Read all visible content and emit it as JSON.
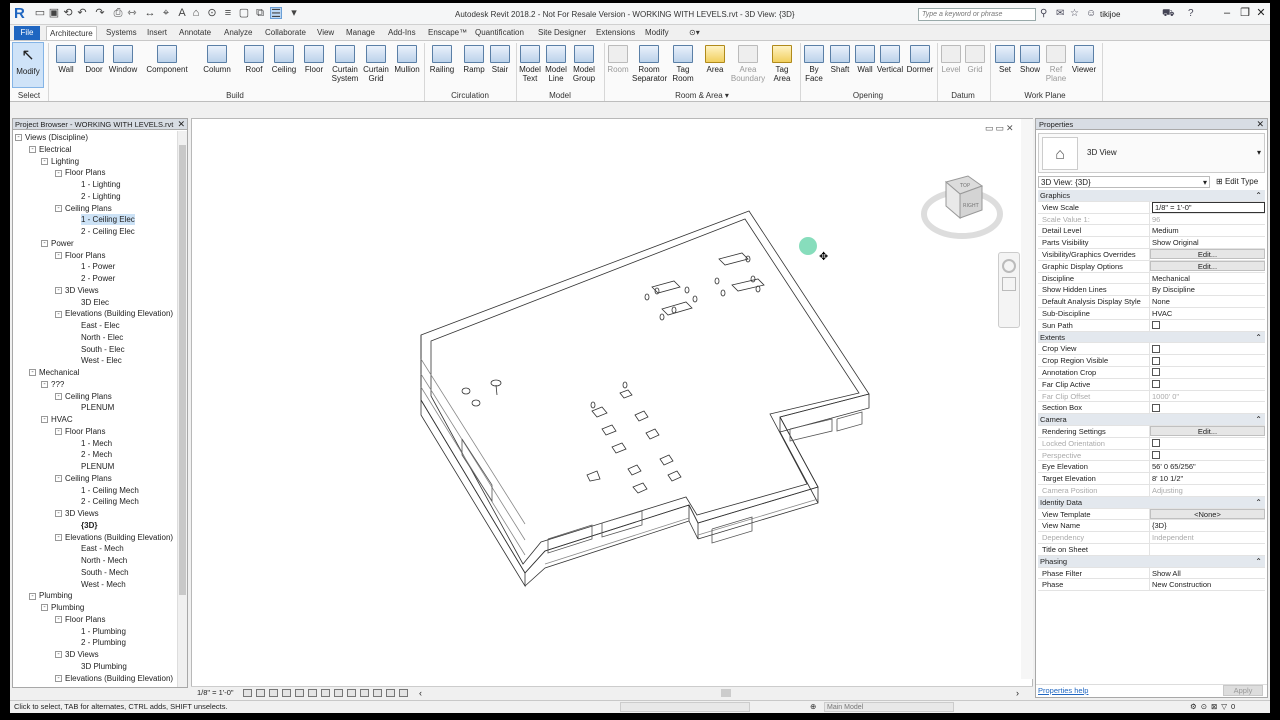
{
  "titlebar": {
    "window_title": "Autodesk Revit 2018.2 - Not For Resale Version -    WORKING WITH LEVELS.rvt - 3D View: {3D}",
    "search_placeholder": "Type a keyword or phrase",
    "username": "tikijoe"
  },
  "tabs": [
    "File",
    "Architecture",
    "Systems",
    "Insert",
    "Annotate",
    "Analyze",
    "Collaborate",
    "View",
    "Manage",
    "Add-Ins",
    "Enscape™",
    "Quantification",
    "Site Designer",
    "Extensions",
    "Modify"
  ],
  "ribbon": {
    "select_label": "Select",
    "modify": "Modify",
    "build": [
      "Wall",
      "Door",
      "Window",
      "Component",
      "Column",
      "Roof",
      "Ceiling",
      "Floor",
      "Curtain System",
      "Curtain Grid",
      "Mullion"
    ],
    "circulation": [
      "Railing",
      "Ramp",
      "Stair"
    ],
    "model": [
      "Model Text",
      "Model Line",
      "Model Group"
    ],
    "room_area": [
      "Room",
      "Room Separator",
      "Tag Room",
      "Area",
      "Area Boundary",
      "Tag Area"
    ],
    "opening": [
      "By Face",
      "Shaft",
      "Wall",
      "Vertical",
      "Dormer"
    ],
    "datum": [
      "Level",
      "Grid"
    ],
    "work_plane": [
      "Set",
      "Show",
      "Ref Plane",
      "Viewer"
    ],
    "panels": {
      "build": "Build",
      "circulation": "Circulation",
      "model": "Model",
      "room_area": "Room & Area",
      "opening": "Opening",
      "datum": "Datum",
      "work_plane": "Work Plane"
    }
  },
  "project_browser": {
    "title": "Project Browser - WORKING WITH LEVELS.rvt",
    "tree": [
      {
        "label": "Views (Discipline)",
        "level": 0,
        "toggle": "-"
      },
      {
        "label": "Electrical",
        "level": 1,
        "toggle": "-"
      },
      {
        "label": "Lighting",
        "level": 2,
        "toggle": "-"
      },
      {
        "label": "Floor Plans",
        "level": 3,
        "toggle": "-"
      },
      {
        "label": "1 - Lighting",
        "level": 4
      },
      {
        "label": "2 - Lighting",
        "level": 4
      },
      {
        "label": "Ceiling Plans",
        "level": 3,
        "toggle": "-"
      },
      {
        "label": "1 - Ceiling Elec",
        "level": 4,
        "selected": true
      },
      {
        "label": "2 - Ceiling Elec",
        "level": 4
      },
      {
        "label": "Power",
        "level": 2,
        "toggle": "-"
      },
      {
        "label": "Floor Plans",
        "level": 3,
        "toggle": "-"
      },
      {
        "label": "1 - Power",
        "level": 4
      },
      {
        "label": "2 - Power",
        "level": 4
      },
      {
        "label": "3D Views",
        "level": 3,
        "toggle": "-"
      },
      {
        "label": "3D Elec",
        "level": 4
      },
      {
        "label": "Elevations (Building Elevation)",
        "level": 3,
        "toggle": "-"
      },
      {
        "label": "East - Elec",
        "level": 4
      },
      {
        "label": "North - Elec",
        "level": 4
      },
      {
        "label": "South - Elec",
        "level": 4
      },
      {
        "label": "West - Elec",
        "level": 4
      },
      {
        "label": "Mechanical",
        "level": 1,
        "toggle": "-"
      },
      {
        "label": "???",
        "level": 2,
        "toggle": "-"
      },
      {
        "label": "Ceiling Plans",
        "level": 3,
        "toggle": "-"
      },
      {
        "label": "PLENUM",
        "level": 4
      },
      {
        "label": "HVAC",
        "level": 2,
        "toggle": "-"
      },
      {
        "label": "Floor Plans",
        "level": 3,
        "toggle": "-"
      },
      {
        "label": "1 - Mech",
        "level": 4
      },
      {
        "label": "2 - Mech",
        "level": 4
      },
      {
        "label": "PLENUM",
        "level": 4
      },
      {
        "label": "Ceiling Plans",
        "level": 3,
        "toggle": "-"
      },
      {
        "label": "1 - Ceiling Mech",
        "level": 4
      },
      {
        "label": "2 - Ceiling Mech",
        "level": 4
      },
      {
        "label": "3D Views",
        "level": 3,
        "toggle": "-"
      },
      {
        "label": "{3D}",
        "level": 4,
        "bold": true
      },
      {
        "label": "Elevations (Building Elevation)",
        "level": 3,
        "toggle": "-"
      },
      {
        "label": "East - Mech",
        "level": 4
      },
      {
        "label": "North - Mech",
        "level": 4
      },
      {
        "label": "South - Mech",
        "level": 4
      },
      {
        "label": "West - Mech",
        "level": 4
      },
      {
        "label": "Plumbing",
        "level": 1,
        "toggle": "-"
      },
      {
        "label": "Plumbing",
        "level": 2,
        "toggle": "-"
      },
      {
        "label": "Floor Plans",
        "level": 3,
        "toggle": "-"
      },
      {
        "label": "1 - Plumbing",
        "level": 4
      },
      {
        "label": "2 - Plumbing",
        "level": 4
      },
      {
        "label": "3D Views",
        "level": 3,
        "toggle": "-"
      },
      {
        "label": "3D Plumbing",
        "level": 4
      },
      {
        "label": "Elevations (Building Elevation)",
        "level": 3,
        "toggle": "-"
      }
    ]
  },
  "viewcube": {
    "top": "TOP",
    "right": "RIGHT"
  },
  "view_control_bar": {
    "scale": "1/8\" = 1'-0\""
  },
  "properties": {
    "title": "Properties",
    "type_name": "3D View",
    "instance": "3D View: {3D}",
    "edit_type": "Edit Type",
    "rows": [
      {
        "cat": "Graphics"
      },
      {
        "name": "View Scale",
        "value": "1/8\" = 1'-0\"",
        "boxed": true
      },
      {
        "name": "Scale Value    1:",
        "value": "96",
        "dim": true
      },
      {
        "name": "Detail Level",
        "value": "Medium"
      },
      {
        "name": "Parts Visibility",
        "value": "Show Original"
      },
      {
        "name": "Visibility/Graphics Overrides",
        "value": "Edit...",
        "button": true
      },
      {
        "name": "Graphic Display Options",
        "value": "Edit...",
        "button": true
      },
      {
        "name": "Discipline",
        "value": "Mechanical"
      },
      {
        "name": "Show Hidden Lines",
        "value": "By Discipline"
      },
      {
        "name": "Default Analysis Display Style",
        "value": "None"
      },
      {
        "name": "Sub-Discipline",
        "value": "HVAC"
      },
      {
        "name": "Sun Path",
        "check": true
      },
      {
        "cat": "Extents"
      },
      {
        "name": "Crop View",
        "check": true
      },
      {
        "name": "Crop Region Visible",
        "check": true
      },
      {
        "name": "Annotation Crop",
        "check": true
      },
      {
        "name": "Far Clip Active",
        "check": true
      },
      {
        "name": "Far Clip Offset",
        "value": "1000'  0\"",
        "dim": true
      },
      {
        "name": "Section Box",
        "check": true
      },
      {
        "cat": "Camera"
      },
      {
        "name": "Rendering Settings",
        "value": "Edit...",
        "button": true
      },
      {
        "name": "Locked Orientation",
        "dim": true,
        "check": true
      },
      {
        "name": "Perspective",
        "dim": true,
        "check": true
      },
      {
        "name": "Eye Elevation",
        "value": "56'  0 65/256\""
      },
      {
        "name": "Target Elevation",
        "value": "8'  10 1/2\""
      },
      {
        "name": "Camera Position",
        "value": "Adjusting",
        "dim": true
      },
      {
        "cat": "Identity Data"
      },
      {
        "name": "View Template",
        "value": "<None>",
        "button": true
      },
      {
        "name": "View Name",
        "value": "{3D}"
      },
      {
        "name": "Dependency",
        "value": "Independent",
        "dim": true
      },
      {
        "name": "Title on Sheet",
        "value": ""
      },
      {
        "cat": "Phasing"
      },
      {
        "name": "Phase Filter",
        "value": "Show All"
      },
      {
        "name": "Phase",
        "value": "New Construction"
      }
    ],
    "help": "Properties help",
    "apply": "Apply"
  },
  "statusbar": {
    "text": "Click to select, TAB for alternates, CTRL adds, SHIFT unselects.",
    "model": "Main Model"
  }
}
